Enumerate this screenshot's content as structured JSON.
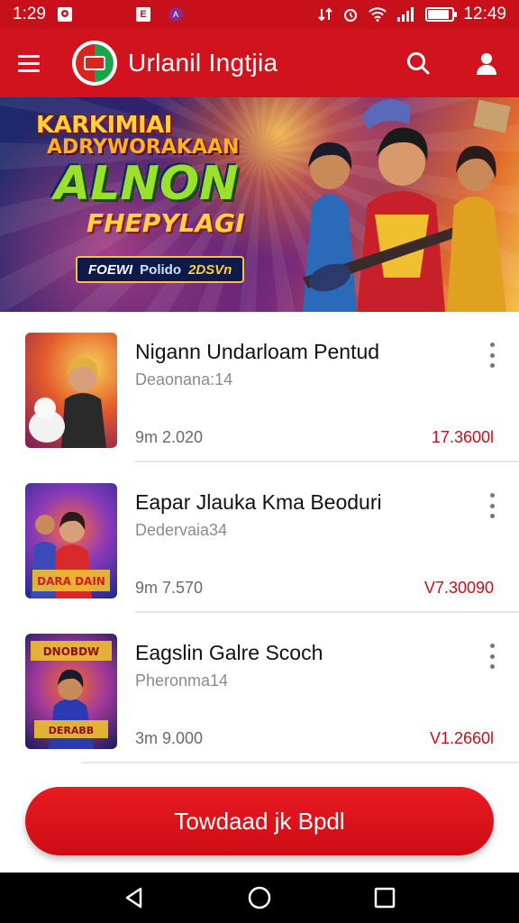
{
  "status_bar": {
    "time": "1:29",
    "right_time": "12:49",
    "notif_letter": "E",
    "notif_letter2": "A",
    "battery_level": 0.85
  },
  "app_bar": {
    "title": "Urlanil Ingtjia",
    "icons": [
      "menu-icon",
      "search-icon",
      "profile-icon"
    ]
  },
  "banner": {
    "line1": "KARKIMIAI",
    "line2": "ADRYWORAKAAN",
    "line3": "ALNON",
    "line4": "FHEPYLAGI",
    "pill": {
      "a": "FOEWI",
      "b": "Polido",
      "c": "2DSVn"
    }
  },
  "items": [
    {
      "title": "Nigann Undarloam Pentud",
      "subtitle": "Deaonana:14",
      "meta": "9m 2.020",
      "price": "17.3600l"
    },
    {
      "title": "Eapar Jlauka Kma Beoduri",
      "subtitle": "Dedervaia34",
      "meta": "9m 7.570",
      "price": "V7.30090"
    },
    {
      "title": "Eagslin Galre Scoch",
      "subtitle": "Pheronma14",
      "meta": "3m 9.000",
      "price": "V1.2660l"
    }
  ],
  "cta": {
    "label": "Towdaad jk Bpdl"
  },
  "colors": {
    "primary": "#d0131c",
    "price": "#c8101a",
    "nav": "#000000"
  }
}
